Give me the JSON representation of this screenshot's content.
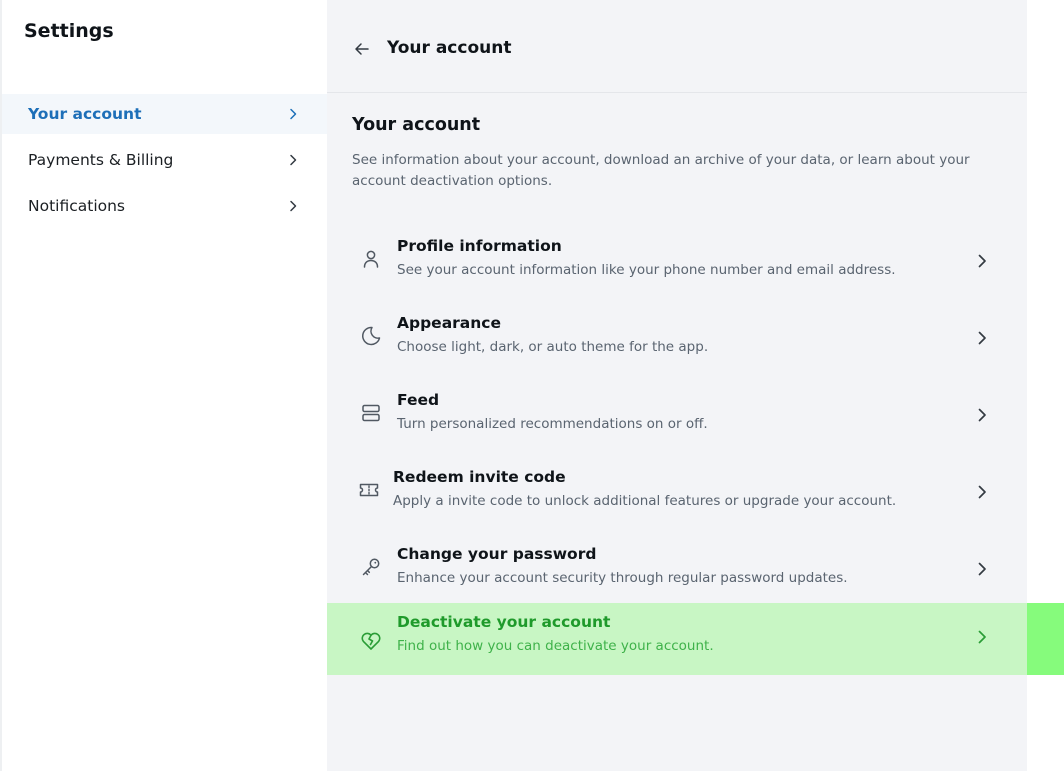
{
  "sidebar": {
    "title": "Settings",
    "items": [
      {
        "label": "Your account",
        "active": true
      },
      {
        "label": "Payments & Billing",
        "active": false
      },
      {
        "label": "Notifications",
        "active": false
      }
    ]
  },
  "main": {
    "header_title": "Your account",
    "section_title": "Your account",
    "section_description": "See information about your account, download an archive of your data, or learn about your account deactivation options.",
    "rows": [
      {
        "title": "Profile information",
        "subtitle": "See your account information like your phone number and email address.",
        "icon": "user-icon"
      },
      {
        "title": "Appearance",
        "subtitle": "Choose light, dark, or auto theme for the app.",
        "icon": "moon-icon"
      },
      {
        "title": "Feed",
        "subtitle": "Turn personalized recommendations on or off.",
        "icon": "feed-icon"
      },
      {
        "title": "Redeem invite code",
        "subtitle": "Apply a invite code to unlock additional features or upgrade your account.",
        "icon": "ticket-icon"
      },
      {
        "title": "Change your password",
        "subtitle": "Enhance your account security through regular password updates.",
        "icon": "key-icon"
      },
      {
        "title": "Deactivate your account",
        "subtitle": "Find out how you can deactivate your account.",
        "icon": "broken-heart-icon"
      }
    ]
  },
  "colors": {
    "accent": "#1d6fb8",
    "highlight_band": "#86fb7c",
    "highlight_row": "#c8f6c4",
    "highlight_text": "#1f9a2b",
    "panel_bg": "#f3f4f7"
  }
}
